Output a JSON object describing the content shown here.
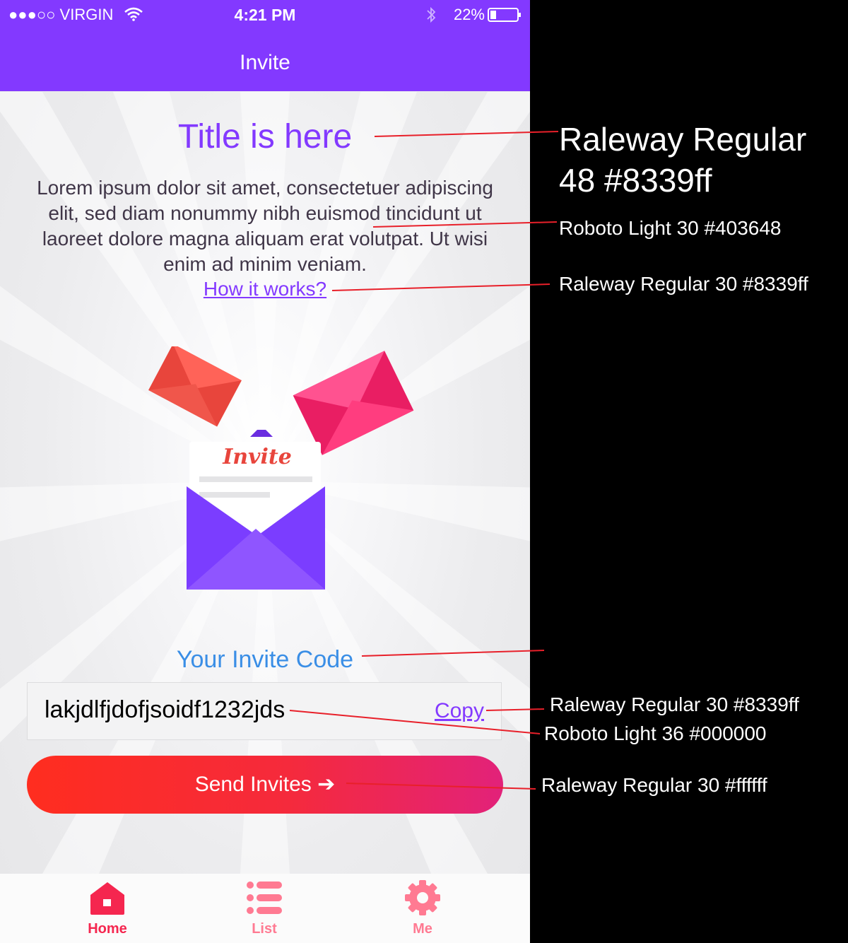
{
  "status_bar": {
    "carrier": "●●●○○ VIRGIN",
    "time": "4:21 PM",
    "battery": "22%"
  },
  "nav": {
    "title": "Invite"
  },
  "content": {
    "title": "Title is here",
    "body": "Lorem ipsum dolor sit amet, consectetuer adipiscing elit, sed diam nonummy nibh euismod tincidunt ut laoreet dolore magna aliquam erat volutpat. Ut wisi enim ad minim veniam.",
    "how_link": "How it works?",
    "illustration_text": "Invite",
    "code_label": "Your Invite Code",
    "code_value": "lakjdlfjdofjsoidf1232jds",
    "copy_label": "Copy",
    "send_label": "Send Invites ➔"
  },
  "tabs": [
    {
      "label": "Home",
      "icon": "home-icon",
      "color": "#f5264f"
    },
    {
      "label": "List",
      "icon": "list-icon",
      "color": "#ff7a92"
    },
    {
      "label": "Me",
      "icon": "gear-icon",
      "color": "#ff7a92"
    }
  ],
  "annotations": {
    "title_spec": [
      "Raleway Regular",
      "48 #8339ff"
    ],
    "body_spec": "Roboto Light 30 #403648",
    "link_spec": "Raleway Regular 30 #8339ff",
    "copy_spec": "Raleway Regular 30 #8339ff",
    "code_spec": "Roboto Light 36 #000000",
    "button_spec": "Raleway Regular 30 #ffffff"
  },
  "colors": {
    "accent": "#8339ff",
    "body_text": "#403648",
    "code_label": "#3a8ee6",
    "button_start": "#ff2d1f",
    "button_end": "#e2227a",
    "annotation_line": "#e8202a"
  }
}
